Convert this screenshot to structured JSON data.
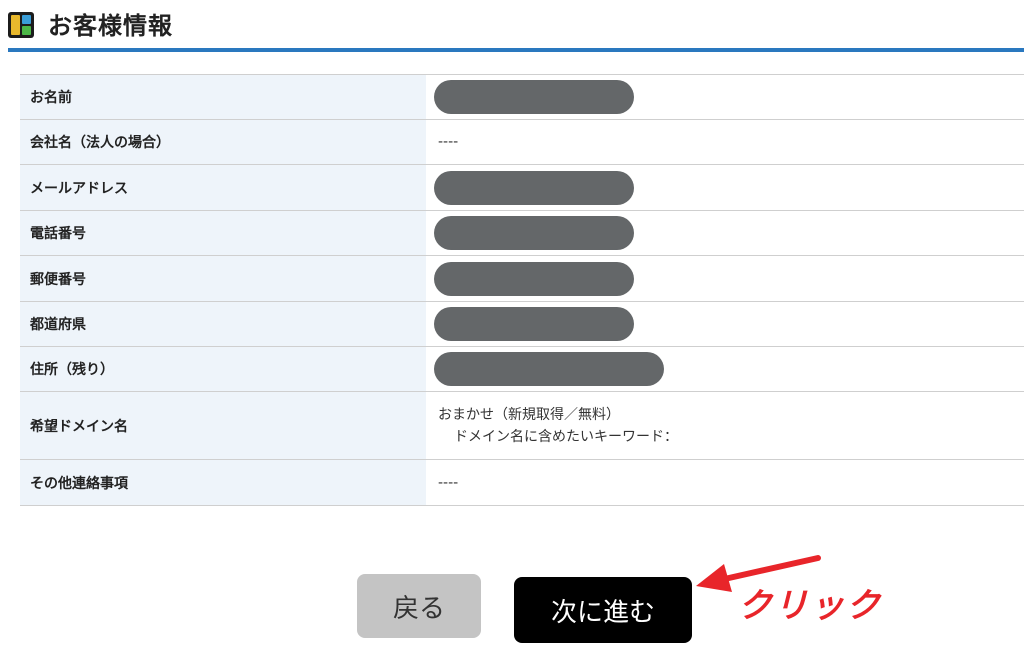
{
  "header": {
    "title": "お客様情報"
  },
  "rows": [
    {
      "label": "お名前",
      "value": "",
      "redacted": true
    },
    {
      "label": "会社名（法人の場合）",
      "value": "----",
      "redacted": false
    },
    {
      "label": "メールアドレス",
      "value": "",
      "redacted": true
    },
    {
      "label": "電話番号",
      "value": "",
      "redacted": true
    },
    {
      "label": "郵便番号",
      "value": "",
      "redacted": true
    },
    {
      "label": "都道府県",
      "value": "",
      "redacted": true
    },
    {
      "label": "住所（残り）",
      "value": "",
      "redacted": true
    },
    {
      "label": "希望ドメイン名",
      "value_line1": "おまかせ（新規取得／無料）",
      "value_line2": "ドメイン名に含めたいキーワード："
    },
    {
      "label": "その他連絡事項",
      "value": "----",
      "redacted": false
    }
  ],
  "buttons": {
    "back": "戻る",
    "next": "次に進む"
  },
  "annotation": {
    "text": "クリック",
    "color": "#e8252a"
  },
  "colors": {
    "accent": "#2a78bf",
    "label_bg": "#eef4fa",
    "redaction": "#646769"
  }
}
